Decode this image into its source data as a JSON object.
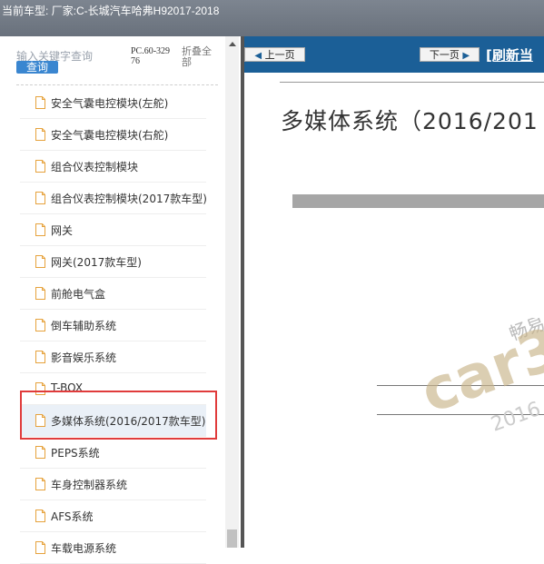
{
  "header": {
    "title": "当前车型:  厂家:C-长城汽车哈弗H92017-2018"
  },
  "sidebar": {
    "search_placeholder": "输入关键字查询",
    "search_button": "查询",
    "pc_number": "PC.60-32976",
    "collapse_label": "折叠全部",
    "items": [
      {
        "label": "安全气囊电控模块(左舵)"
      },
      {
        "label": "安全气囊电控模块(右舵)"
      },
      {
        "label": "组合仪表控制模块"
      },
      {
        "label": "组合仪表控制模块(2017款车型)"
      },
      {
        "label": "网关"
      },
      {
        "label": "网关(2017款车型)"
      },
      {
        "label": "前舱电气盒"
      },
      {
        "label": "倒车辅助系统"
      },
      {
        "label": "影音娱乐系统"
      },
      {
        "label": "T-BOX"
      },
      {
        "label": "多媒体系统(2016/2017款车型)",
        "selected": true
      },
      {
        "label": "PEPS系统"
      },
      {
        "label": "车身控制器系统"
      },
      {
        "label": "AFS系统"
      },
      {
        "label": "车载电源系统"
      }
    ]
  },
  "toolbar": {
    "prev_label": "上一页",
    "next_label": "下一页",
    "refresh_label": "[刷新当"
  },
  "document": {
    "title": "多媒体系统（2016/201",
    "watermark_brand": "car3",
    "watermark_text": "畅易",
    "watermark_year": "2016"
  },
  "colors": {
    "highlight": "#e03b3b",
    "navbar": "#1b5f97",
    "search_button": "#3a86d0"
  }
}
